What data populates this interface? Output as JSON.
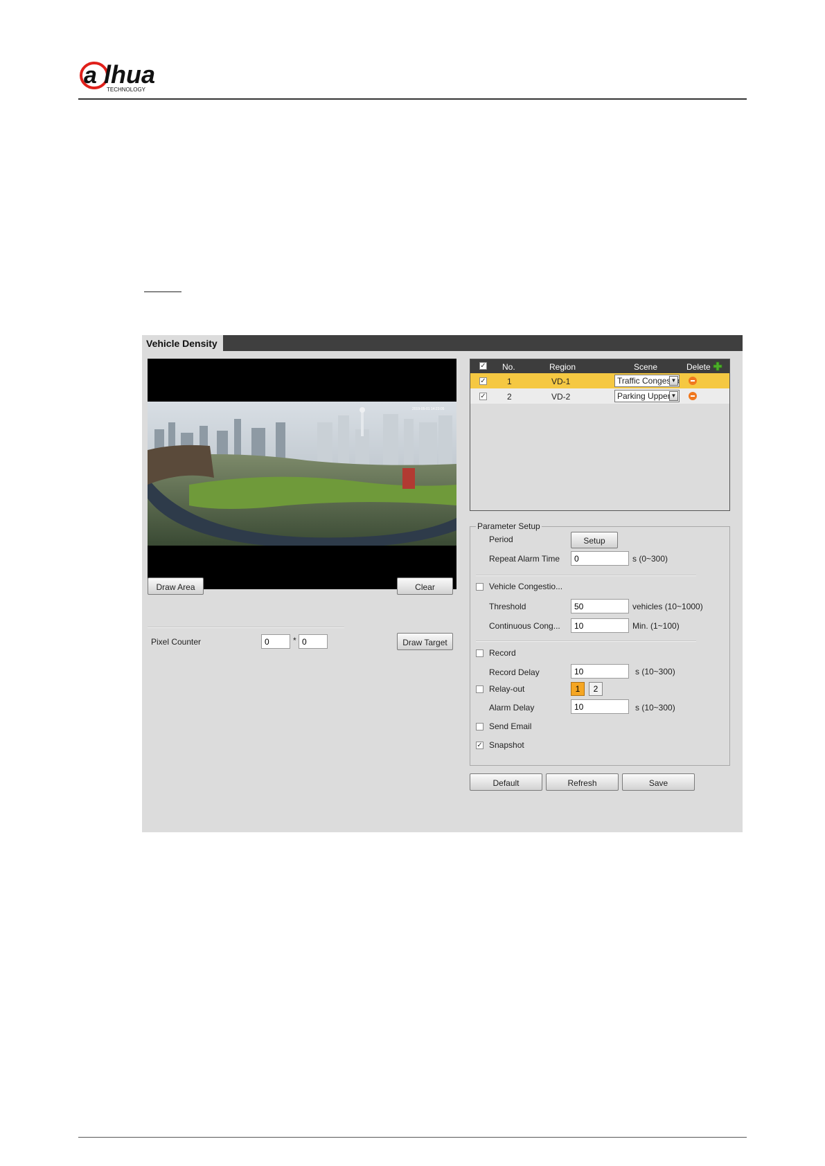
{
  "brand": {
    "logo_text": "alhua",
    "logo_sub": "TECHNOLOGY"
  },
  "panel": {
    "tab_title": "Vehicle Density",
    "video": {
      "overlay_text": "2019-05-01 14:23:05"
    },
    "buttons": {
      "draw_area": "Draw Area",
      "clear": "Clear",
      "draw_target": "Draw Target",
      "default": "Default",
      "refresh": "Refresh",
      "save": "Save"
    },
    "pixel_counter": {
      "label": "Pixel Counter",
      "width": "0",
      "separator": "*",
      "height": "0"
    },
    "rules_table": {
      "headers": {
        "no": "No.",
        "region": "Region",
        "scene": "Scene",
        "delete": "Delete"
      },
      "rows": [
        {
          "checked": true,
          "no": "1",
          "region": "VD-1",
          "scene": "Traffic Congestion",
          "selected": true
        },
        {
          "checked": true,
          "no": "2",
          "region": "VD-2",
          "scene": "Parking Upper",
          "selected": false
        }
      ]
    },
    "params": {
      "legend": "Parameter Setup",
      "period_label": "Period",
      "setup_button": "Setup",
      "repeat_alarm_label": "Repeat Alarm Time",
      "repeat_alarm_value": "0",
      "repeat_alarm_unit": "s (0~300)",
      "vehicle_congestion_label": "Vehicle Congestio...",
      "vehicle_congestion_checked": false,
      "threshold_label": "Threshold",
      "threshold_value": "50",
      "threshold_unit": "vehicles (10~1000)",
      "continuous_label": "Continuous Cong...",
      "continuous_value": "10",
      "continuous_unit": "Min. (1~100)",
      "record_label": "Record",
      "record_checked": false,
      "record_delay_label": "Record Delay",
      "record_delay_value": "10",
      "record_delay_unit": "s (10~300)",
      "relay_label": "Relay-out",
      "relay_checked": false,
      "relay_1": "1",
      "relay_2": "2",
      "alarm_delay_label": "Alarm Delay",
      "alarm_delay_value": "10",
      "alarm_delay_unit": "s (10~300)",
      "send_email_label": "Send Email",
      "send_email_checked": false,
      "snapshot_label": "Snapshot",
      "snapshot_checked": true
    }
  },
  "colors": {
    "panel_bg": "#dcdcdc",
    "title_bar": "#3f3f3f",
    "selected_row": "#f5c842",
    "relay_active": "#f5a623",
    "delete_icon": "#f0781e",
    "add_icon": "#4caf2a",
    "logo_red": "#e0201a"
  }
}
